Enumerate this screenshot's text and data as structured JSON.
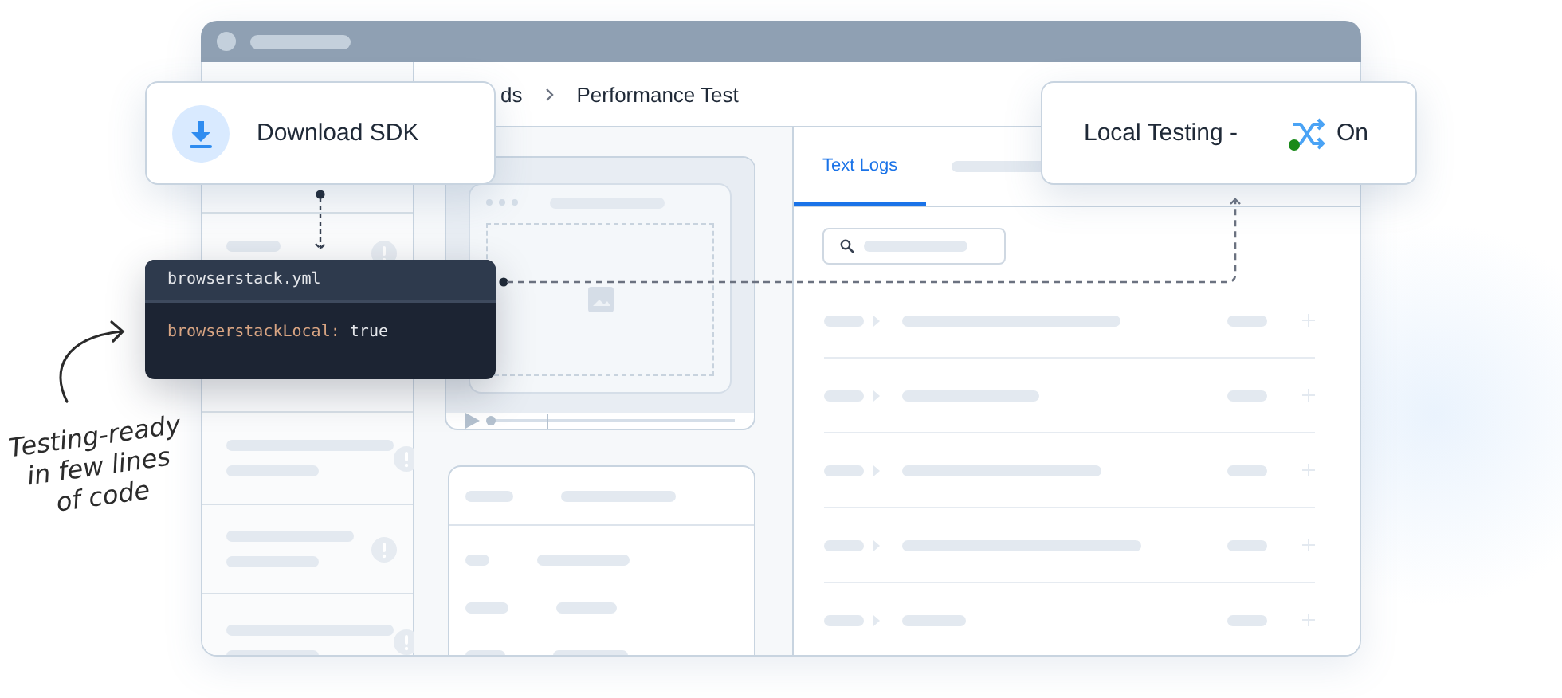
{
  "breadcrumb": [
    "ds",
    "Performance Test"
  ],
  "tabs": [
    {
      "label": "Text Logs",
      "selected": true
    }
  ],
  "download_card": {
    "label": "Download SDK"
  },
  "code_card": {
    "filename": "browserstack.yml",
    "key": "browserstackLocal:",
    "value": "true"
  },
  "local_testing_card": {
    "label": "Local Testing -",
    "state": "On",
    "on": true
  },
  "annotation": {
    "lines": [
      "Testing-ready",
      "in few lines",
      "of code"
    ]
  }
}
